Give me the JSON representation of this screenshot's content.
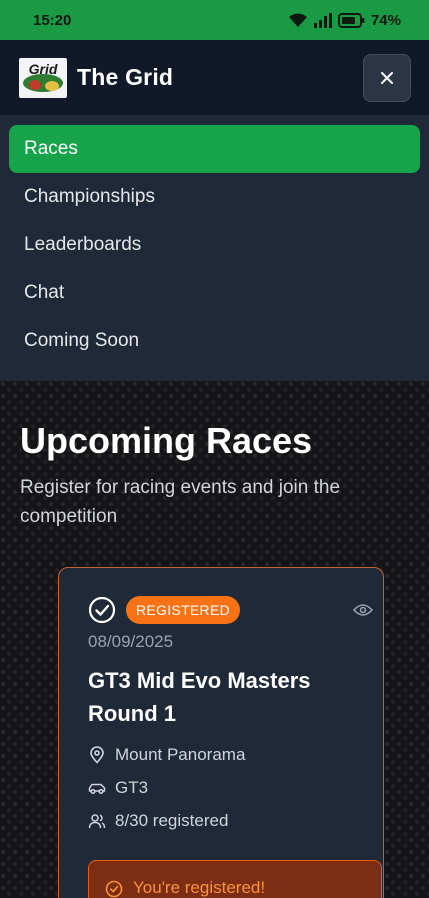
{
  "status_bar": {
    "time": "15:20",
    "battery": "74%"
  },
  "app": {
    "title": "The Grid",
    "logo_text": "Grid"
  },
  "menu": {
    "items": [
      {
        "label": "Races",
        "active": true
      },
      {
        "label": "Championships",
        "active": false
      },
      {
        "label": "Leaderboards",
        "active": false
      },
      {
        "label": "Chat",
        "active": false
      },
      {
        "label": "Coming Soon",
        "active": false
      }
    ]
  },
  "page": {
    "title": "Upcoming Races",
    "subtitle": "Register for racing events and join the competition"
  },
  "race_card": {
    "badge": "REGISTERED",
    "date": "08/09/2025",
    "title": "GT3 Mid Evo Masters Round 1",
    "track": "Mount Panorama",
    "car_class": "GT3",
    "registrations": "8/30 registered",
    "registered_notice": "You're registered!"
  },
  "colors": {
    "status_bar": "#1a9a45",
    "active_menu": "#16a34a",
    "badge": "#f97316",
    "card_border": "#c2622c"
  }
}
